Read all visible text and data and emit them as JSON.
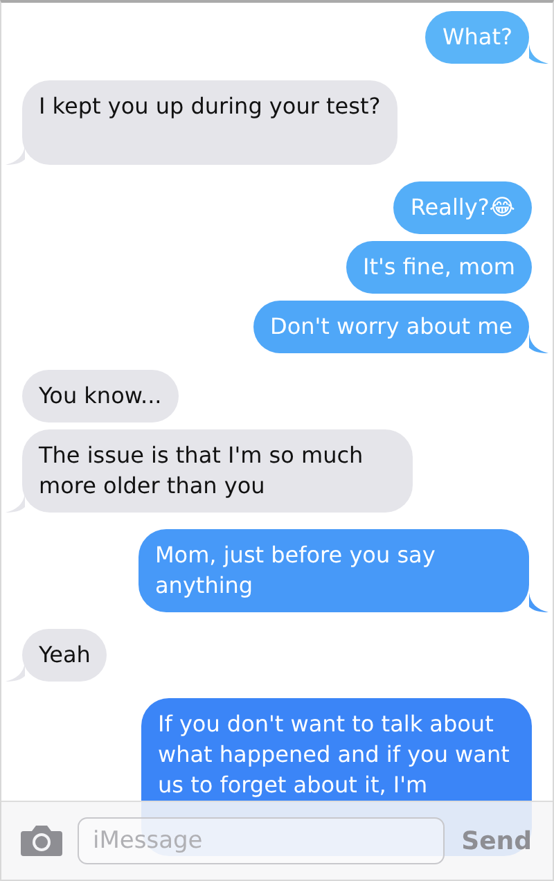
{
  "messages": [
    {
      "kind": "sent",
      "text": "What?",
      "color": "#5ab4f8",
      "tail": true
    },
    {
      "kind": "received",
      "text": "I kept you up during your test?",
      "color": "#e5e5ea",
      "tail": true
    },
    {
      "kind": "sent",
      "text": "Really?😂",
      "color": "#54aef8",
      "tail": false
    },
    {
      "kind": "sent",
      "text": "It's fine, mom",
      "color": "#52abf8",
      "tail": false
    },
    {
      "kind": "sent",
      "text": "Don't worry about me",
      "color": "#4fa7f8",
      "tail": true
    },
    {
      "kind": "received",
      "text": "You know...",
      "color": "#e5e5ea",
      "tail": false
    },
    {
      "kind": "received",
      "text": "The issue is that I'm so much more older than you",
      "color": "#e5e5ea",
      "tail": true
    },
    {
      "kind": "sent",
      "text": "Mom, just before you say anything",
      "color": "#4799f8",
      "tail": true
    },
    {
      "kind": "received",
      "text": "Yeah",
      "color": "#e5e5ea",
      "tail": true
    },
    {
      "kind": "sent",
      "text": "If you don't want to talk about what happened and if you want us to forget about it, I'm",
      "color": "#3b85f7",
      "tail": false
    }
  ],
  "composer": {
    "placeholder": "iMessage",
    "send": "Send"
  }
}
